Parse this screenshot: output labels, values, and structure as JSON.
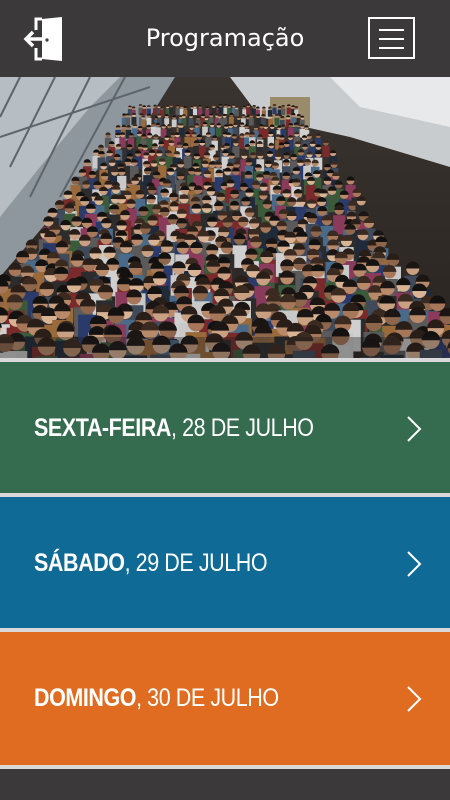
{
  "header": {
    "title": "Programação",
    "exit_icon": "exit-door-icon",
    "menu_icon": "hamburger-menu-icon"
  },
  "hero": {
    "image": "crowd-photo"
  },
  "days": [
    {
      "day": "SEXTA-FEIRA",
      "date": ", 28 DE JULHO",
      "color": "#356b4e",
      "icon": "chevron-right-icon"
    },
    {
      "day": "SÁBADO",
      "date": ", 29 DE JULHO",
      "color": "#0f6b95",
      "icon": "chevron-right-icon"
    },
    {
      "day": "DOMINGO",
      "date": ", 30 DE JULHO",
      "color": "#e06c22",
      "icon": "chevron-right-icon"
    }
  ],
  "colors": {
    "header_bg": "#3b3939",
    "separator": "#d9d9d9"
  }
}
